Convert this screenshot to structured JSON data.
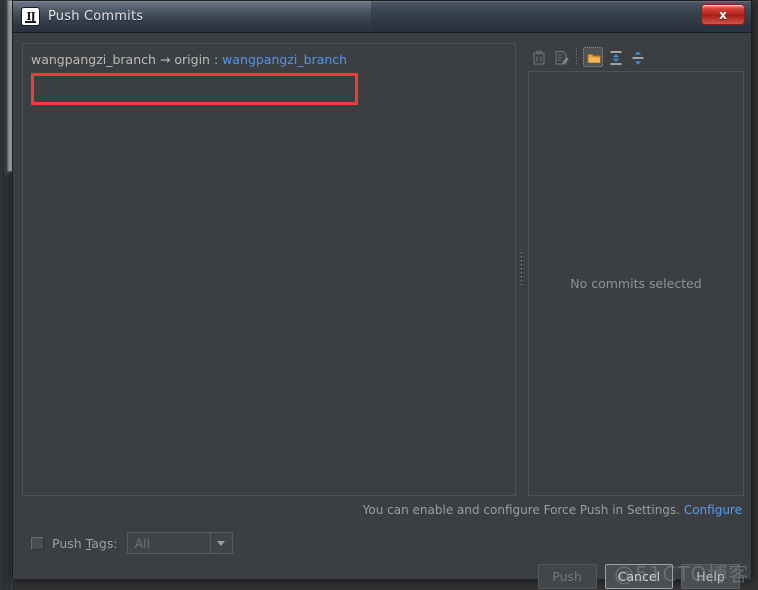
{
  "window": {
    "title": "Push Commits",
    "app_icon": "intellij-idea-icon",
    "close_label": "x",
    "close_icon": "close-icon"
  },
  "tree_panel": {
    "branch_source": "wangpangzi_branch",
    "arrow": "→",
    "remote_label": "origin :",
    "branch_target": "wangpangzi_branch",
    "full_line": "wangpangzi_branch → origin : wangpangzi_branch"
  },
  "annotation": {
    "shape": "red-highlight-rectangle",
    "color": "#f4393b"
  },
  "detail_panel": {
    "empty_message": "No commits selected",
    "toolbar": [
      {
        "name": "show-diff-icon",
        "label": "Show Diff",
        "state": "disabled"
      },
      {
        "name": "edit-commit-message-icon",
        "label": "Edit Commit Message",
        "state": "disabled"
      },
      {
        "name": "group-by-directory-icon",
        "label": "Group By Directory",
        "state": "selected"
      },
      {
        "name": "expand-all-icon",
        "label": "Expand All",
        "state": "enabled"
      },
      {
        "name": "collapse-all-icon",
        "label": "Collapse All",
        "state": "enabled"
      }
    ]
  },
  "force_push_hint": {
    "text": "You can enable and configure Force Push in Settings.",
    "link_label": "Configure"
  },
  "push_tags": {
    "checked": false,
    "label_before": "Push ",
    "label_mnemonic": "T",
    "label_after": "ags:",
    "selected_value": "All",
    "dropdown_icon": "chevron-down-icon",
    "enabled": false
  },
  "buttons": {
    "push": "Push",
    "cancel": "Cancel",
    "help": "Help"
  },
  "watermark": {
    "text": "@51CTO博客"
  },
  "colors": {
    "dialog_background": "#3c3f41",
    "titlebar_top": "#4e5a68",
    "titlebar_bottom": "#283240",
    "link_blue": "#5394ec",
    "annotation_red": "#f4393b",
    "accent_orange": "#e8a33d",
    "accent_blue_icon": "#3d90d8",
    "text_primary": "#bbbbbb",
    "text_muted": "#8f9295",
    "close_button_red": "#d9443a"
  }
}
